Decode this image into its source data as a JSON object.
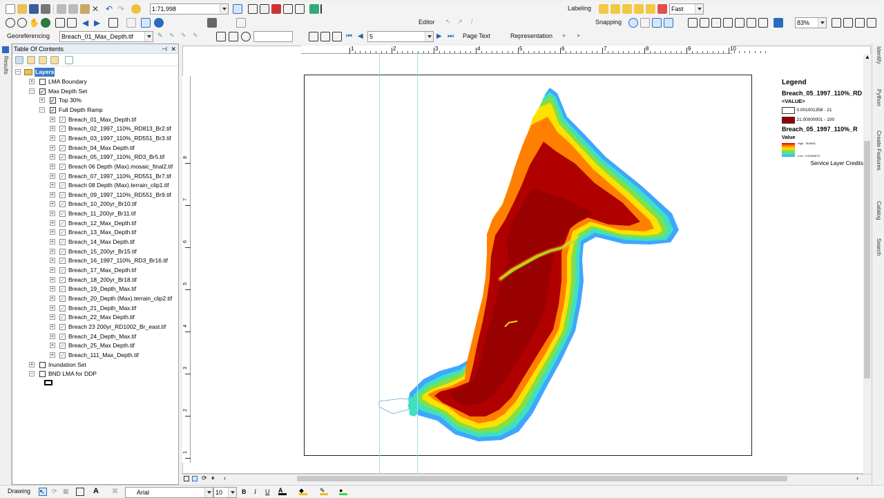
{
  "toolbar1": {
    "scale": "1:71,998",
    "labeling_label": "Labeling",
    "fast_value": "Fast"
  },
  "toolbar2": {
    "editor_label": "Editor",
    "snapping_label": "Snapping",
    "zoom_value": "83%"
  },
  "toolbar3": {
    "georef_label": "Georeferencing",
    "georef_layer": "Breach_01_Max_Depth.tif",
    "page_number": "5",
    "page_text_label": "Page Text",
    "representation_label": "Representation"
  },
  "toc": {
    "title": "Table Of Contents",
    "layers_root": "Layers",
    "items": [
      {
        "label": "LMA Boundary",
        "level": 1,
        "expander": "+",
        "checked": false
      },
      {
        "label": "Max Depth Set",
        "level": 1,
        "expander": "−",
        "checked": true
      },
      {
        "label": "Top 30%",
        "level": 2,
        "expander": "+",
        "checked": true
      },
      {
        "label": "Full Depth Ramp",
        "level": 2,
        "expander": "−",
        "checked": true
      },
      {
        "label": "Breach_01_Max_Depth.tif",
        "level": 3,
        "expander": "+",
        "checked": true
      },
      {
        "label": "Breach_02_1997_110%_RD813_Br2.tif",
        "level": 3,
        "expander": "+",
        "checked": true
      },
      {
        "label": "Breach_03_1997_110%_RD551_Br3.tif",
        "level": 3,
        "expander": "+",
        "checked": true
      },
      {
        "label": "Breach_04_Max Depth.tif",
        "level": 3,
        "expander": "+",
        "checked": true
      },
      {
        "label": "Breach_05_1997_110%_RD3_Br5.tif",
        "level": 3,
        "expander": "+",
        "checked": true
      },
      {
        "label": "Breach 06 Depth (Max).mosaic_final2.tif",
        "level": 3,
        "expander": "+",
        "checked": true
      },
      {
        "label": "Breach_07_1997_110%_RD551_Br7.tif",
        "level": 3,
        "expander": "+",
        "checked": true
      },
      {
        "label": "Breach 08 Depth (Max).terrain_clip1.tif",
        "level": 3,
        "expander": "+",
        "checked": true
      },
      {
        "label": "Breach_09_1997_110%_RD551_Br9.tif",
        "level": 3,
        "expander": "+",
        "checked": true
      },
      {
        "label": "Breach_10_200yr_Br10.tif",
        "level": 3,
        "expander": "+",
        "checked": true
      },
      {
        "label": "Breach_11_200yr_Br11.tif",
        "level": 3,
        "expander": "+",
        "checked": true
      },
      {
        "label": "Breach_12_Max_Depth.tif",
        "level": 3,
        "expander": "+",
        "checked": true
      },
      {
        "label": "Breach_13_Max_Depth.tif",
        "level": 3,
        "expander": "+",
        "checked": true
      },
      {
        "label": "Breach_14_Max Depth.tif",
        "level": 3,
        "expander": "+",
        "checked": true
      },
      {
        "label": "Breach_15_200yr_Br15.tif",
        "level": 3,
        "expander": "+",
        "checked": true
      },
      {
        "label": "Breach_16_1997_110%_RD3_Br16.tif",
        "level": 3,
        "expander": "+",
        "checked": true
      },
      {
        "label": "Breach_17_Max_Depth.tif",
        "level": 3,
        "expander": "+",
        "checked": true
      },
      {
        "label": "Breach_18_200yr_Br18.tif",
        "level": 3,
        "expander": "+",
        "checked": true
      },
      {
        "label": "Breach_19_Depth_Max.tif",
        "level": 3,
        "expander": "+",
        "checked": true
      },
      {
        "label": "Breach_20_Depth (Max).terrain_clip2.tif",
        "level": 3,
        "expander": "+",
        "checked": true
      },
      {
        "label": "Breach_21_Depth_Max.tif",
        "level": 3,
        "expander": "+",
        "checked": true
      },
      {
        "label": "Breach_22_Max Depth.tif",
        "level": 3,
        "expander": "+",
        "checked": true
      },
      {
        "label": "Breach 23 200yr_RD1002_Br_east.tif",
        "level": 3,
        "expander": "+",
        "checked": true
      },
      {
        "label": "Breach_24_Depth_Max.tif",
        "level": 3,
        "expander": "+",
        "checked": true
      },
      {
        "label": "Breach_25_Max Depth.tif",
        "level": 3,
        "expander": "+",
        "checked": true
      },
      {
        "label": "Breach_111_Max_Depth.tif",
        "level": 3,
        "expander": "+",
        "checked": true
      },
      {
        "label": "Inundation Set",
        "level": 1,
        "expander": "+",
        "checked": false
      },
      {
        "label": "BND LMA for DDP",
        "level": 1,
        "expander": "−",
        "checked": false
      }
    ]
  },
  "side_tabs": {
    "left": "Results",
    "right": [
      "Identify",
      "Python",
      "Create Features",
      "Catalog",
      "Search"
    ]
  },
  "ruler": {
    "h_ticks": [
      "1",
      "2",
      "3",
      "4",
      "5",
      "6",
      "7",
      "8",
      "9",
      "10"
    ],
    "v_ticks": [
      "8",
      "7",
      "6",
      "5",
      "4",
      "3",
      "2",
      "1"
    ]
  },
  "legend": {
    "title": "Legend",
    "layer1_name": "Breach_05_1997_110%_RD",
    "layer1_field": "<VALUE>",
    "class1_label": "0.001001358 - 21",
    "class2_label": "21.00000001 - 100",
    "class1_color": "#ffffff",
    "class2_color": "#990000",
    "layer2_name": "Breach_05_1997_110%_R",
    "layer2_field": "Value",
    "high_label": "High : 36.8831",
    "low_label": "Low : 0.00283679",
    "credits": "Service Layer Credits"
  },
  "drawing_toolbar": {
    "drawing_label": "Drawing",
    "font_name": "Arial",
    "font_size": "10",
    "bold_label": "B",
    "italic_label": "I",
    "underline_label": "U"
  }
}
